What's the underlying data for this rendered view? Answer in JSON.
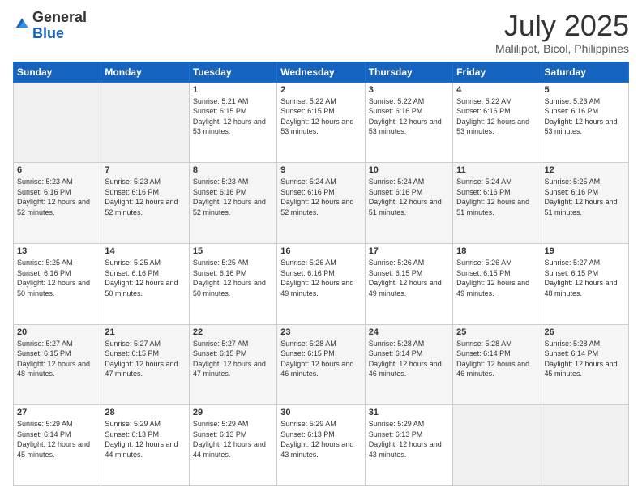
{
  "logo": {
    "general": "General",
    "blue": "Blue"
  },
  "header": {
    "month": "July 2025",
    "location": "Malilipot, Bicol, Philippines"
  },
  "days_of_week": [
    "Sunday",
    "Monday",
    "Tuesday",
    "Wednesday",
    "Thursday",
    "Friday",
    "Saturday"
  ],
  "weeks": [
    [
      {
        "day": "",
        "sunrise": "",
        "sunset": "",
        "daylight": ""
      },
      {
        "day": "",
        "sunrise": "",
        "sunset": "",
        "daylight": ""
      },
      {
        "day": "1",
        "sunrise": "Sunrise: 5:21 AM",
        "sunset": "Sunset: 6:15 PM",
        "daylight": "Daylight: 12 hours and 53 minutes."
      },
      {
        "day": "2",
        "sunrise": "Sunrise: 5:22 AM",
        "sunset": "Sunset: 6:15 PM",
        "daylight": "Daylight: 12 hours and 53 minutes."
      },
      {
        "day": "3",
        "sunrise": "Sunrise: 5:22 AM",
        "sunset": "Sunset: 6:16 PM",
        "daylight": "Daylight: 12 hours and 53 minutes."
      },
      {
        "day": "4",
        "sunrise": "Sunrise: 5:22 AM",
        "sunset": "Sunset: 6:16 PM",
        "daylight": "Daylight: 12 hours and 53 minutes."
      },
      {
        "day": "5",
        "sunrise": "Sunrise: 5:23 AM",
        "sunset": "Sunset: 6:16 PM",
        "daylight": "Daylight: 12 hours and 53 minutes."
      }
    ],
    [
      {
        "day": "6",
        "sunrise": "Sunrise: 5:23 AM",
        "sunset": "Sunset: 6:16 PM",
        "daylight": "Daylight: 12 hours and 52 minutes."
      },
      {
        "day": "7",
        "sunrise": "Sunrise: 5:23 AM",
        "sunset": "Sunset: 6:16 PM",
        "daylight": "Daylight: 12 hours and 52 minutes."
      },
      {
        "day": "8",
        "sunrise": "Sunrise: 5:23 AM",
        "sunset": "Sunset: 6:16 PM",
        "daylight": "Daylight: 12 hours and 52 minutes."
      },
      {
        "day": "9",
        "sunrise": "Sunrise: 5:24 AM",
        "sunset": "Sunset: 6:16 PM",
        "daylight": "Daylight: 12 hours and 52 minutes."
      },
      {
        "day": "10",
        "sunrise": "Sunrise: 5:24 AM",
        "sunset": "Sunset: 6:16 PM",
        "daylight": "Daylight: 12 hours and 51 minutes."
      },
      {
        "day": "11",
        "sunrise": "Sunrise: 5:24 AM",
        "sunset": "Sunset: 6:16 PM",
        "daylight": "Daylight: 12 hours and 51 minutes."
      },
      {
        "day": "12",
        "sunrise": "Sunrise: 5:25 AM",
        "sunset": "Sunset: 6:16 PM",
        "daylight": "Daylight: 12 hours and 51 minutes."
      }
    ],
    [
      {
        "day": "13",
        "sunrise": "Sunrise: 5:25 AM",
        "sunset": "Sunset: 6:16 PM",
        "daylight": "Daylight: 12 hours and 50 minutes."
      },
      {
        "day": "14",
        "sunrise": "Sunrise: 5:25 AM",
        "sunset": "Sunset: 6:16 PM",
        "daylight": "Daylight: 12 hours and 50 minutes."
      },
      {
        "day": "15",
        "sunrise": "Sunrise: 5:25 AM",
        "sunset": "Sunset: 6:16 PM",
        "daylight": "Daylight: 12 hours and 50 minutes."
      },
      {
        "day": "16",
        "sunrise": "Sunrise: 5:26 AM",
        "sunset": "Sunset: 6:16 PM",
        "daylight": "Daylight: 12 hours and 49 minutes."
      },
      {
        "day": "17",
        "sunrise": "Sunrise: 5:26 AM",
        "sunset": "Sunset: 6:15 PM",
        "daylight": "Daylight: 12 hours and 49 minutes."
      },
      {
        "day": "18",
        "sunrise": "Sunrise: 5:26 AM",
        "sunset": "Sunset: 6:15 PM",
        "daylight": "Daylight: 12 hours and 49 minutes."
      },
      {
        "day": "19",
        "sunrise": "Sunrise: 5:27 AM",
        "sunset": "Sunset: 6:15 PM",
        "daylight": "Daylight: 12 hours and 48 minutes."
      }
    ],
    [
      {
        "day": "20",
        "sunrise": "Sunrise: 5:27 AM",
        "sunset": "Sunset: 6:15 PM",
        "daylight": "Daylight: 12 hours and 48 minutes."
      },
      {
        "day": "21",
        "sunrise": "Sunrise: 5:27 AM",
        "sunset": "Sunset: 6:15 PM",
        "daylight": "Daylight: 12 hours and 47 minutes."
      },
      {
        "day": "22",
        "sunrise": "Sunrise: 5:27 AM",
        "sunset": "Sunset: 6:15 PM",
        "daylight": "Daylight: 12 hours and 47 minutes."
      },
      {
        "day": "23",
        "sunrise": "Sunrise: 5:28 AM",
        "sunset": "Sunset: 6:15 PM",
        "daylight": "Daylight: 12 hours and 46 minutes."
      },
      {
        "day": "24",
        "sunrise": "Sunrise: 5:28 AM",
        "sunset": "Sunset: 6:14 PM",
        "daylight": "Daylight: 12 hours and 46 minutes."
      },
      {
        "day": "25",
        "sunrise": "Sunrise: 5:28 AM",
        "sunset": "Sunset: 6:14 PM",
        "daylight": "Daylight: 12 hours and 46 minutes."
      },
      {
        "day": "26",
        "sunrise": "Sunrise: 5:28 AM",
        "sunset": "Sunset: 6:14 PM",
        "daylight": "Daylight: 12 hours and 45 minutes."
      }
    ],
    [
      {
        "day": "27",
        "sunrise": "Sunrise: 5:29 AM",
        "sunset": "Sunset: 6:14 PM",
        "daylight": "Daylight: 12 hours and 45 minutes."
      },
      {
        "day": "28",
        "sunrise": "Sunrise: 5:29 AM",
        "sunset": "Sunset: 6:13 PM",
        "daylight": "Daylight: 12 hours and 44 minutes."
      },
      {
        "day": "29",
        "sunrise": "Sunrise: 5:29 AM",
        "sunset": "Sunset: 6:13 PM",
        "daylight": "Daylight: 12 hours and 44 minutes."
      },
      {
        "day": "30",
        "sunrise": "Sunrise: 5:29 AM",
        "sunset": "Sunset: 6:13 PM",
        "daylight": "Daylight: 12 hours and 43 minutes."
      },
      {
        "day": "31",
        "sunrise": "Sunrise: 5:29 AM",
        "sunset": "Sunset: 6:13 PM",
        "daylight": "Daylight: 12 hours and 43 minutes."
      },
      {
        "day": "",
        "sunrise": "",
        "sunset": "",
        "daylight": ""
      },
      {
        "day": "",
        "sunrise": "",
        "sunset": "",
        "daylight": ""
      }
    ]
  ]
}
